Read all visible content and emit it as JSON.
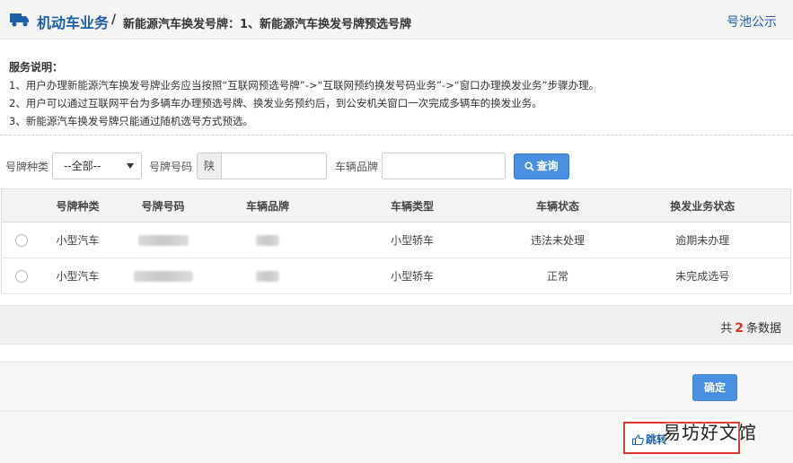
{
  "header": {
    "section_title": "机动车业务",
    "separator": "/",
    "subtitle": "新能源汽车换发号牌：1、新能源汽车换发号牌预选号牌",
    "right_link": "号池公示"
  },
  "description": {
    "title": "服务说明：",
    "lines": [
      "1、用户办理新能源汽车换发号牌业务应当按照“互联网预选号牌”->“互联网预约换发号码业务”->“窗口办理换发业务”步骤办理。",
      "2、用户可以通过互联网平台为多辆车办理预选号牌、换发业务预约后，到公安机关窗口一次完成多辆车的换发业务。",
      "3、新能源汽车换发号牌只能通过随机选号方式预选。"
    ]
  },
  "filter": {
    "plate_type_label": "号牌种类",
    "plate_type_value": "--全部--",
    "plate_number_label": "号牌号码",
    "plate_prefix": "陕",
    "plate_number_value": "",
    "brand_label": "车辆品牌",
    "brand_value": "",
    "search_label": "查询"
  },
  "table": {
    "columns": [
      "号牌种类",
      "号牌号码",
      "车辆品牌",
      "车辆类型",
      "车辆状态",
      "换发业务状态"
    ],
    "rows": [
      {
        "plate_type": "小型汽车",
        "vehicle_type": "小型轿车",
        "vehicle_status": "违法未处理",
        "business_status": "逾期未办理"
      },
      {
        "plate_type": "小型汽车",
        "vehicle_type": "小型轿车",
        "vehicle_status": "正常",
        "business_status": "未完成选号"
      }
    ]
  },
  "summary": {
    "prefix": "共",
    "count": "2",
    "suffix": "条数据"
  },
  "confirm_label": "确定",
  "jump_label": "跳转",
  "watermark": "易坊好文馆",
  "colors": {
    "brand_blue": "#1d5fa8",
    "button_blue": "#4a90e2",
    "highlight_red": "#e0332d"
  }
}
